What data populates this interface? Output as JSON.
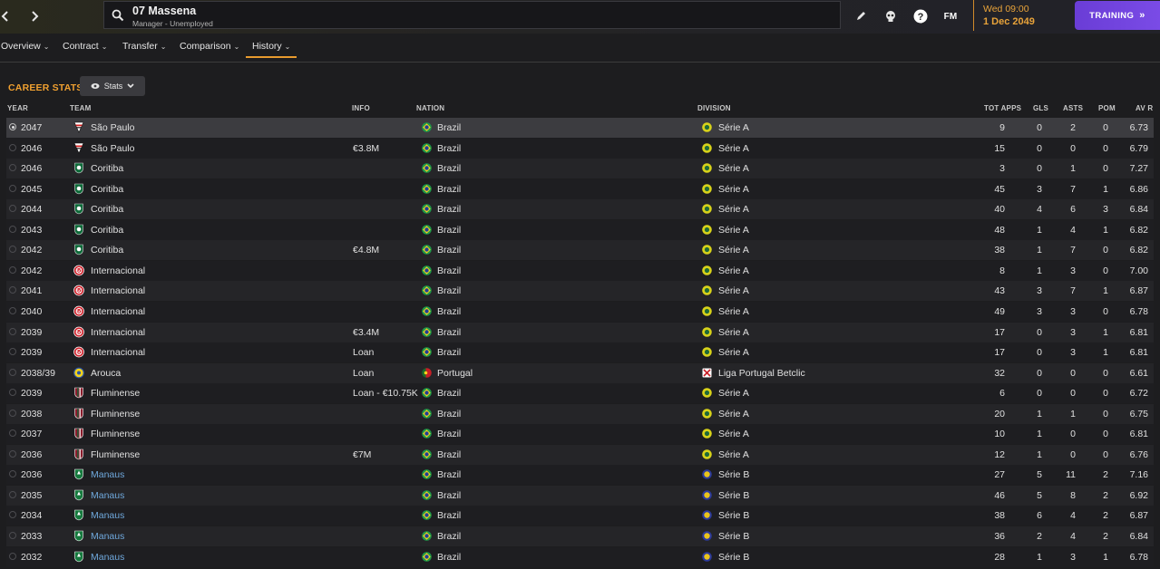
{
  "header": {
    "player_name": "07 Massena",
    "player_status": "Manager - Unemployed",
    "date_time": "Wed 09:00",
    "date_day": "1 Dec 2049",
    "training_label": "TRAINING",
    "fm_logo": "FM"
  },
  "icons": {
    "back": "chevron-left-icon",
    "forward": "chevron-right-icon",
    "search": "search-icon",
    "edit": "pencil-icon",
    "skull": "skull-icon",
    "help": "help-icon",
    "training": "double-chevron-icon"
  },
  "tabs": [
    {
      "label": "Overview"
    },
    {
      "label": "Contract"
    },
    {
      "label": "Transfer"
    },
    {
      "label": "Comparison"
    },
    {
      "label": "History"
    }
  ],
  "active_tab": "History",
  "section": {
    "title": "CAREER STATS",
    "view_button": "Stats"
  },
  "columns": {
    "year": "YEAR",
    "team": "TEAM",
    "info": "INFO",
    "nation": "NATION",
    "division": "DIVISION",
    "apps": "TOT APPS",
    "gls": "GLS",
    "asts": "ASTS",
    "pom": "POM",
    "avr": "AV R"
  },
  "colors": {
    "accent_orange": "#e89b2e",
    "training_purple": "#7a4be6",
    "link_blue": "#6fa8dc"
  },
  "rows": [
    {
      "year": "2047",
      "team": "São Paulo",
      "crest": "sao-paulo",
      "info": "",
      "nation": "Brazil",
      "division": "Série A",
      "div": "a",
      "apps": "9",
      "gls": "0",
      "asts": "2",
      "pom": "0",
      "avr": "6.73",
      "selected": true,
      "link": false
    },
    {
      "year": "2046",
      "team": "São Paulo",
      "crest": "sao-paulo",
      "info": "€3.8M",
      "nation": "Brazil",
      "division": "Série A",
      "div": "a",
      "apps": "15",
      "gls": "0",
      "asts": "0",
      "pom": "0",
      "avr": "6.79",
      "selected": false,
      "link": false
    },
    {
      "year": "2046",
      "team": "Coritiba",
      "crest": "coritiba",
      "info": "",
      "nation": "Brazil",
      "division": "Série A",
      "div": "a",
      "apps": "3",
      "gls": "0",
      "asts": "1",
      "pom": "0",
      "avr": "7.27",
      "selected": false,
      "link": false
    },
    {
      "year": "2045",
      "team": "Coritiba",
      "crest": "coritiba",
      "info": "",
      "nation": "Brazil",
      "division": "Série A",
      "div": "a",
      "apps": "45",
      "gls": "3",
      "asts": "7",
      "pom": "1",
      "avr": "6.86",
      "selected": false,
      "link": false
    },
    {
      "year": "2044",
      "team": "Coritiba",
      "crest": "coritiba",
      "info": "",
      "nation": "Brazil",
      "division": "Série A",
      "div": "a",
      "apps": "40",
      "gls": "4",
      "asts": "6",
      "pom": "3",
      "avr": "6.84",
      "selected": false,
      "link": false
    },
    {
      "year": "2043",
      "team": "Coritiba",
      "crest": "coritiba",
      "info": "",
      "nation": "Brazil",
      "division": "Série A",
      "div": "a",
      "apps": "48",
      "gls": "1",
      "asts": "4",
      "pom": "1",
      "avr": "6.82",
      "selected": false,
      "link": false
    },
    {
      "year": "2042",
      "team": "Coritiba",
      "crest": "coritiba",
      "info": "€4.8M",
      "nation": "Brazil",
      "division": "Série A",
      "div": "a",
      "apps": "38",
      "gls": "1",
      "asts": "7",
      "pom": "0",
      "avr": "6.82",
      "selected": false,
      "link": false
    },
    {
      "year": "2042",
      "team": "Internacional",
      "crest": "internacional",
      "info": "",
      "nation": "Brazil",
      "division": "Série A",
      "div": "a",
      "apps": "8",
      "gls": "1",
      "asts": "3",
      "pom": "0",
      "avr": "7.00",
      "selected": false,
      "link": false
    },
    {
      "year": "2041",
      "team": "Internacional",
      "crest": "internacional",
      "info": "",
      "nation": "Brazil",
      "division": "Série A",
      "div": "a",
      "apps": "43",
      "gls": "3",
      "asts": "7",
      "pom": "1",
      "avr": "6.87",
      "selected": false,
      "link": false
    },
    {
      "year": "2040",
      "team": "Internacional",
      "crest": "internacional",
      "info": "",
      "nation": "Brazil",
      "division": "Série A",
      "div": "a",
      "apps": "49",
      "gls": "3",
      "asts": "3",
      "pom": "0",
      "avr": "6.78",
      "selected": false,
      "link": false
    },
    {
      "year": "2039",
      "team": "Internacional",
      "crest": "internacional",
      "info": "€3.4M",
      "nation": "Brazil",
      "division": "Série A",
      "div": "a",
      "apps": "17",
      "gls": "0",
      "asts": "3",
      "pom": "1",
      "avr": "6.81",
      "selected": false,
      "link": false
    },
    {
      "year": "2039",
      "team": "Internacional",
      "crest": "internacional",
      "info": "Loan",
      "nation": "Brazil",
      "division": "Série A",
      "div": "a",
      "apps": "17",
      "gls": "0",
      "asts": "3",
      "pom": "1",
      "avr": "6.81",
      "selected": false,
      "link": false
    },
    {
      "year": "2038/39",
      "team": "Arouca",
      "crest": "arouca",
      "info": "Loan",
      "nation": "Portugal",
      "division": "Liga Portugal Betclic",
      "div": "pt",
      "apps": "32",
      "gls": "0",
      "asts": "0",
      "pom": "0",
      "avr": "6.61",
      "selected": false,
      "link": false
    },
    {
      "year": "2039",
      "team": "Fluminense",
      "crest": "fluminense",
      "info": "Loan - €10.75K",
      "nation": "Brazil",
      "division": "Série A",
      "div": "a",
      "apps": "6",
      "gls": "0",
      "asts": "0",
      "pom": "0",
      "avr": "6.72",
      "selected": false,
      "link": false
    },
    {
      "year": "2038",
      "team": "Fluminense",
      "crest": "fluminense",
      "info": "",
      "nation": "Brazil",
      "division": "Série A",
      "div": "a",
      "apps": "20",
      "gls": "1",
      "asts": "1",
      "pom": "0",
      "avr": "6.75",
      "selected": false,
      "link": false
    },
    {
      "year": "2037",
      "team": "Fluminense",
      "crest": "fluminense",
      "info": "",
      "nation": "Brazil",
      "division": "Série A",
      "div": "a",
      "apps": "10",
      "gls": "1",
      "asts": "0",
      "pom": "0",
      "avr": "6.81",
      "selected": false,
      "link": false
    },
    {
      "year": "2036",
      "team": "Fluminense",
      "crest": "fluminense",
      "info": "€7M",
      "nation": "Brazil",
      "division": "Série A",
      "div": "a",
      "apps": "12",
      "gls": "1",
      "asts": "0",
      "pom": "0",
      "avr": "6.76",
      "selected": false,
      "link": false
    },
    {
      "year": "2036",
      "team": "Manaus",
      "crest": "manaus",
      "info": "",
      "nation": "Brazil",
      "division": "Série B",
      "div": "b",
      "apps": "27",
      "gls": "5",
      "asts": "11",
      "pom": "2",
      "avr": "7.16",
      "selected": false,
      "link": true
    },
    {
      "year": "2035",
      "team": "Manaus",
      "crest": "manaus",
      "info": "",
      "nation": "Brazil",
      "division": "Série B",
      "div": "b",
      "apps": "46",
      "gls": "5",
      "asts": "8",
      "pom": "2",
      "avr": "6.92",
      "selected": false,
      "link": true
    },
    {
      "year": "2034",
      "team": "Manaus",
      "crest": "manaus",
      "info": "",
      "nation": "Brazil",
      "division": "Série B",
      "div": "b",
      "apps": "38",
      "gls": "6",
      "asts": "4",
      "pom": "2",
      "avr": "6.87",
      "selected": false,
      "link": true
    },
    {
      "year": "2033",
      "team": "Manaus",
      "crest": "manaus",
      "info": "",
      "nation": "Brazil",
      "division": "Série B",
      "div": "b",
      "apps": "36",
      "gls": "2",
      "asts": "4",
      "pom": "2",
      "avr": "6.84",
      "selected": false,
      "link": true
    },
    {
      "year": "2032",
      "team": "Manaus",
      "crest": "manaus",
      "info": "",
      "nation": "Brazil",
      "division": "Série B",
      "div": "b",
      "apps": "28",
      "gls": "1",
      "asts": "3",
      "pom": "1",
      "avr": "6.78",
      "selected": false,
      "link": true
    }
  ]
}
